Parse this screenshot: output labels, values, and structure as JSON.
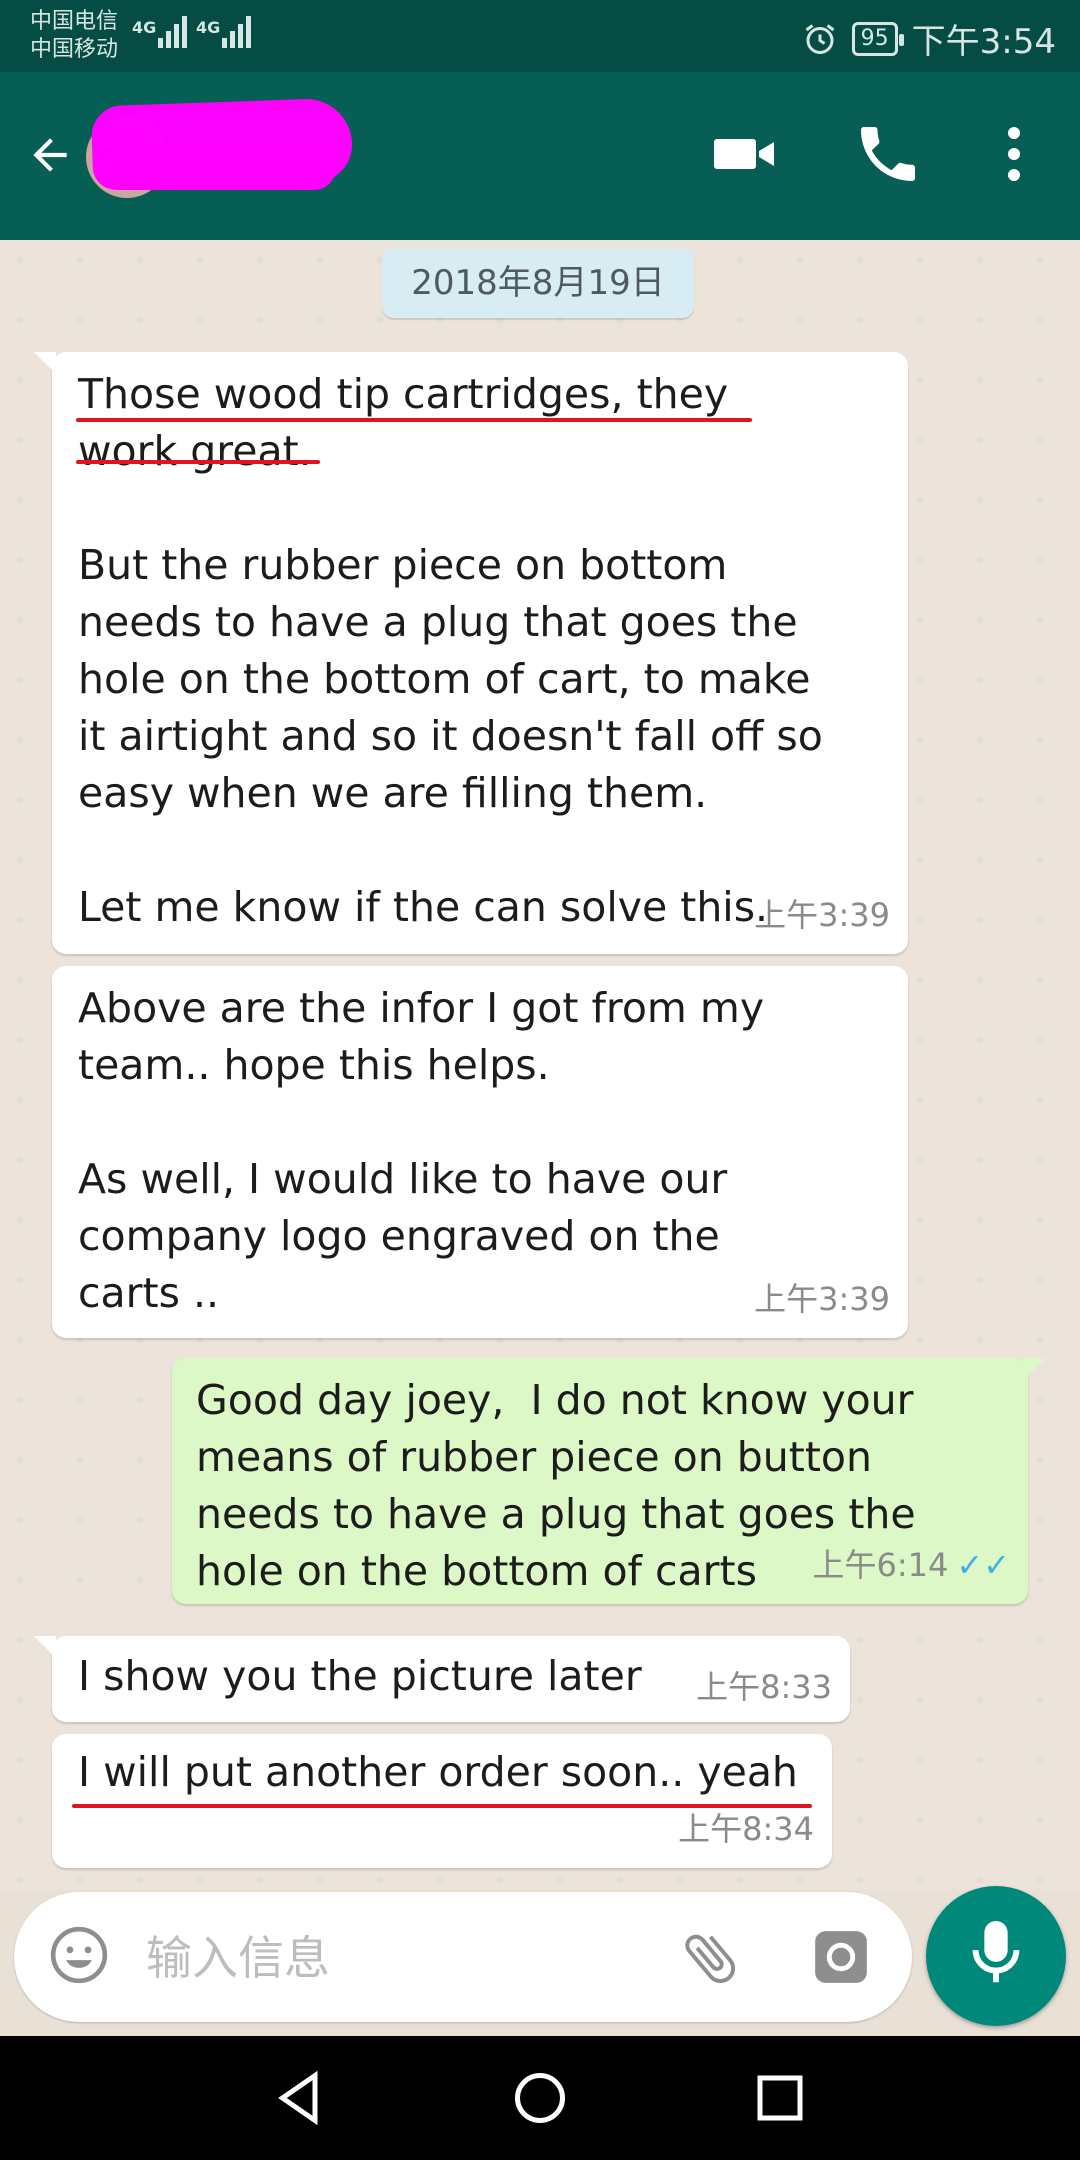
{
  "status_bar": {
    "carrier_1": "中国电信",
    "carrier_2": "中国移动",
    "network_1": "4G",
    "network_2": "4G",
    "battery": "95",
    "time": "下午3:54"
  },
  "app_bar": {
    "contact_name_redacted": true
  },
  "chat": {
    "date_label": "2018年8月19日",
    "messages": [
      {
        "dir": "in",
        "text": "Those wood tip cartridges, they\nwork great.\n\nBut the rubber piece on bottom\nneeds to have a plug that goes the\nhole on the bottom of cart, to make\nit airtight and so it doesn't fall off so\neasy when we are filling them.\n\nLet me know if the can solve this.",
        "time": "上午3:39"
      },
      {
        "dir": "in",
        "text": "Above are the infor I got from my\nteam.. hope this helps.\n\nAs well, I would like to have our\ncompany logo engraved on the\ncarts ..",
        "time": "上午3:39"
      },
      {
        "dir": "out",
        "text": "Good day joey,  I do not know your\nmeans of rubber piece on button\nneeds to have a plug that goes the\nhole on the bottom of carts",
        "time": "上午6:14",
        "status": "read"
      },
      {
        "dir": "in",
        "text": "I show you the picture later",
        "time": "上午8:33"
      },
      {
        "dir": "in",
        "text": "I will put another order soon.. yeah",
        "time": "上午8:34"
      }
    ]
  },
  "composer": {
    "placeholder": "输入信息"
  },
  "colors": {
    "header": "#075e54",
    "status_bar": "#054c44",
    "outgoing_bubble": "#dcf8c6",
    "incoming_bubble": "#ffffff",
    "mic_button": "#00897b",
    "read_ticks": "#43b0e8",
    "annotation_underline": "#e0141e"
  }
}
